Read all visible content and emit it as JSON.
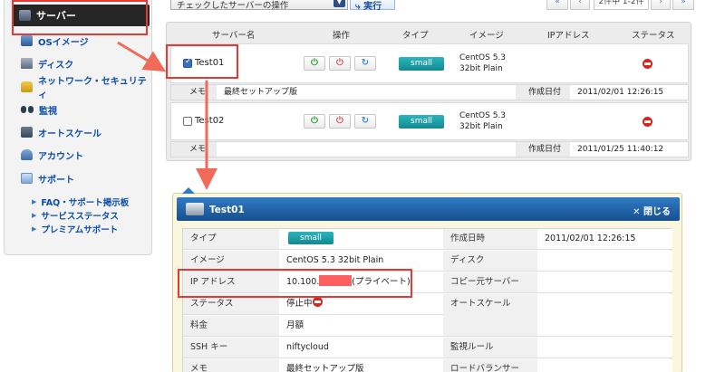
{
  "sidebar": {
    "active": {
      "label": "サーバー",
      "icon": "server-icon"
    },
    "items": [
      {
        "label": "OSイメージ",
        "icon": "os-image-icon"
      },
      {
        "label": "ディスク",
        "icon": "disk-icon"
      },
      {
        "label": "ネットワーク・セキュリティ",
        "icon": "lock-icon"
      },
      {
        "label": "監視",
        "icon": "binoculars-icon"
      },
      {
        "label": "オートスケール",
        "icon": "autoscale-icon"
      },
      {
        "label": "アカウント",
        "icon": "account-icon"
      },
      {
        "label": "サポート",
        "icon": "support-icon"
      }
    ],
    "support_links": [
      "FAQ・サポート掲示板",
      "サービスステータス",
      "プレミアムサポート"
    ]
  },
  "toolbar": {
    "action_select": "チェックしたサーバーの操作",
    "run_label": "実行",
    "pager_first": "«",
    "pager_prev": "‹",
    "pager_info": "2件中 1-2件",
    "pager_next": "›",
    "pager_last": "»"
  },
  "server_list": {
    "columns": [
      "サーバー名",
      "操作",
      "タイプ",
      "イメージ",
      "IPアドレス",
      "ステータス"
    ],
    "memo_label": "メモ",
    "created_label": "作成日付",
    "op_start": "⏻",
    "op_stop": "⏻",
    "op_reload": "↻",
    "rows": [
      {
        "name": "Test01",
        "checked": true,
        "type": "small",
        "image_line1": "CentOS 5.3",
        "image_line2": "32bit Plain",
        "memo": "最終セットアップ版",
        "created": "2011/02/01 12:26:15"
      },
      {
        "name": "Test02",
        "checked": false,
        "type": "small",
        "image_line1": "CentOS 5.3",
        "image_line2": "32bit Plain",
        "memo": "",
        "created": "2011/01/25 11:40:12"
      }
    ]
  },
  "detail": {
    "title": "Test01",
    "close_label": "✕ 閉じる",
    "left": [
      {
        "label": "タイプ",
        "value": "small"
      },
      {
        "label": "イメージ",
        "value": "CentOS 5.3 32bit Plain"
      },
      {
        "label": "IP アドレス",
        "value_prefix": "10.100.",
        "value_suffix": "(プライベート)"
      },
      {
        "label": "ステータス",
        "value": "停止中"
      },
      {
        "label": "料金",
        "value": "月額"
      },
      {
        "label": "SSH キー",
        "value": "niftycloud"
      },
      {
        "label": "メモ",
        "value": "最終セットアップ版"
      }
    ],
    "right": [
      {
        "label": "作成日時",
        "value": "2011/02/01 12:26:15"
      },
      {
        "label": "ディスク",
        "value": ""
      },
      {
        "label": "コピー元サーバー",
        "value": ""
      },
      {
        "label": "オートスケール",
        "value": ""
      },
      {
        "label": "監視ルール",
        "value": ""
      },
      {
        "label": "ロードバランサー",
        "value": ""
      }
    ]
  },
  "colors": {
    "annotation": "#e53935",
    "accent_blue": "#1d5aa3",
    "badge_teal": "#1a9fa6",
    "status_red": "#d7261c"
  }
}
